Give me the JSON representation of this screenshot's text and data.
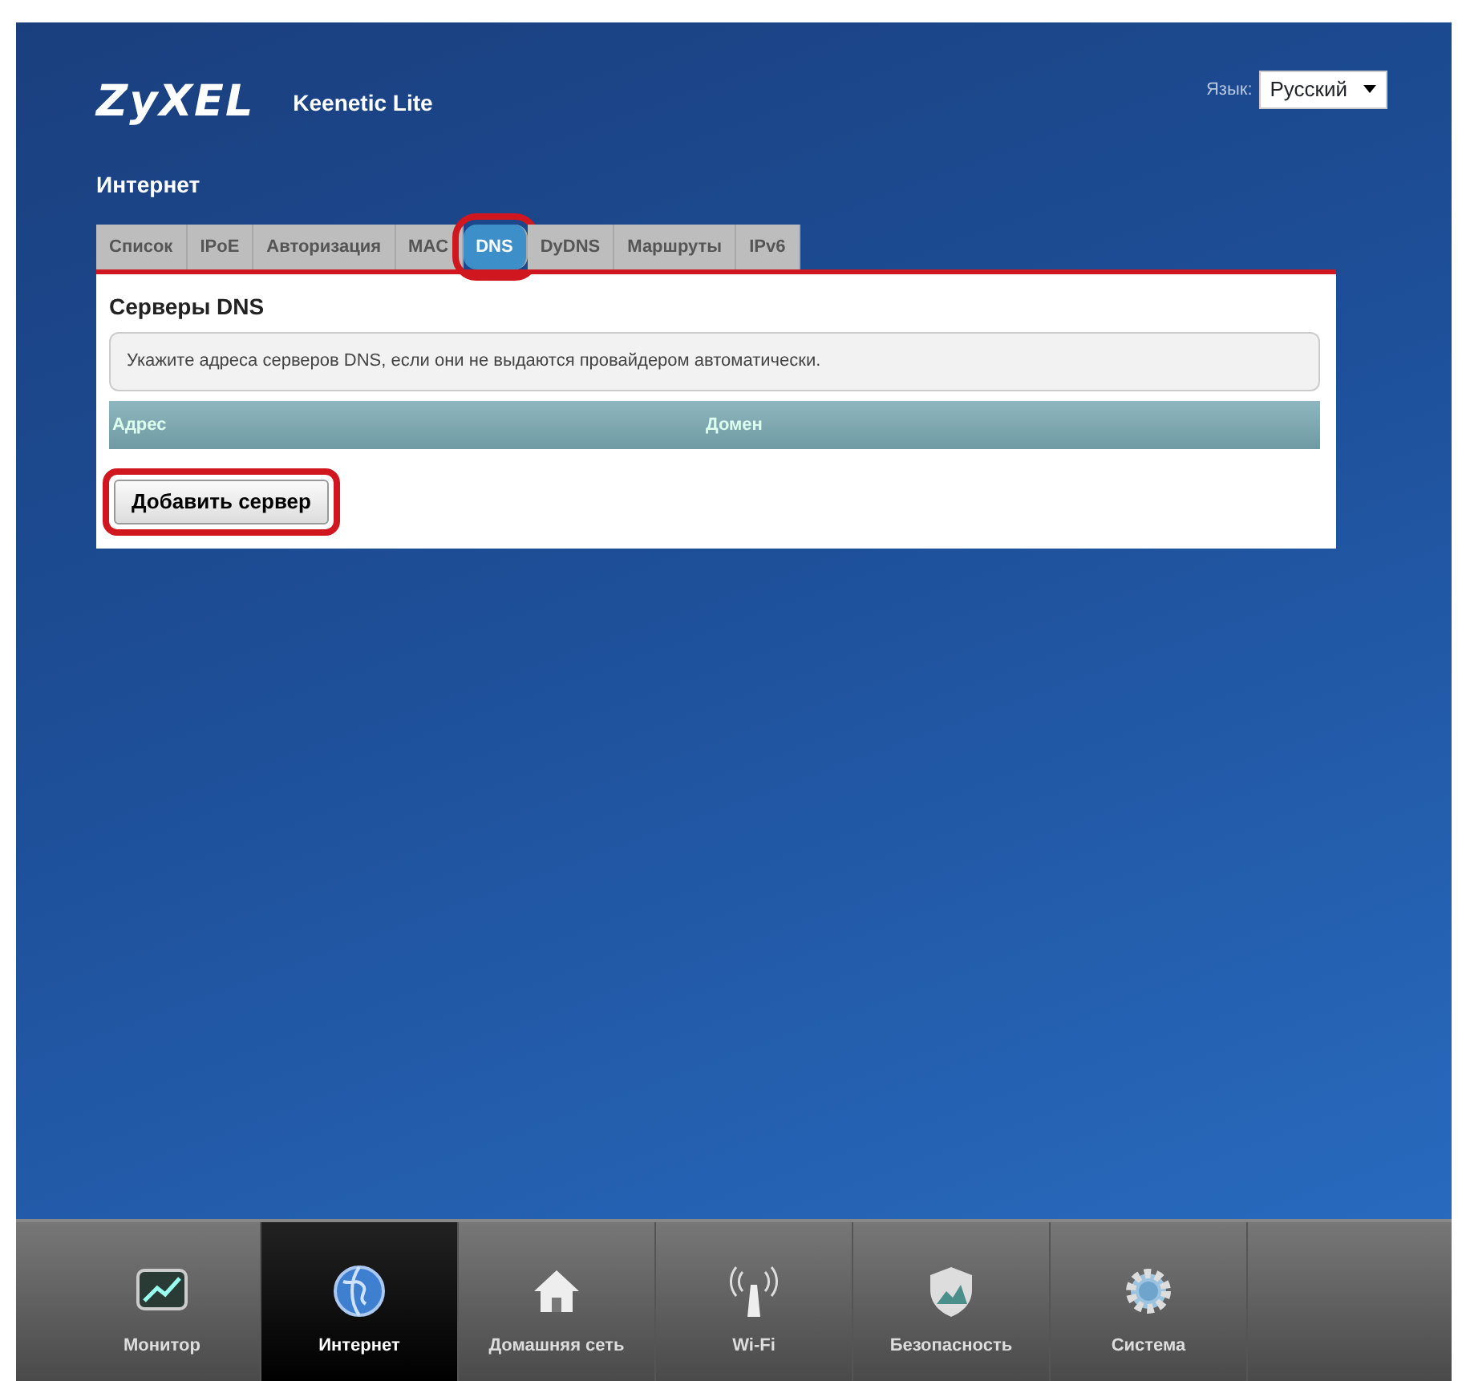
{
  "header": {
    "logo": "ZyXEL",
    "model": "Keenetic Lite",
    "language_label": "Язык:",
    "language_value": "Русский"
  },
  "page_title": "Интернет",
  "tabs": [
    {
      "label": "Список",
      "selected": false,
      "highlighted": false
    },
    {
      "label": "IPoE",
      "selected": false,
      "highlighted": false
    },
    {
      "label": "Авторизация",
      "selected": false,
      "highlighted": false
    },
    {
      "label": "MAC",
      "selected": false,
      "highlighted": false
    },
    {
      "label": "DNS",
      "selected": true,
      "highlighted": true
    },
    {
      "label": "DyDNS",
      "selected": false,
      "highlighted": false
    },
    {
      "label": "Маршруты",
      "selected": false,
      "highlighted": false
    },
    {
      "label": "IPv6",
      "selected": false,
      "highlighted": false
    }
  ],
  "panel": {
    "title": "Серверы DNS",
    "hint": "Укажите адреса серверов DNS, если они не выдаются провайдером автоматически.",
    "table": {
      "columns": [
        "Адрес",
        "Домен"
      ]
    },
    "button": {
      "label": "Добавить сервер",
      "highlighted": true
    }
  },
  "bottom_nav": [
    {
      "label": "Монитор",
      "kind": "monitor",
      "selected": false
    },
    {
      "label": "Интернет",
      "kind": "globe",
      "selected": true
    },
    {
      "label": "Домашняя сеть",
      "kind": "home",
      "selected": false
    },
    {
      "label": "Wi-Fi",
      "kind": "wifi",
      "selected": false
    },
    {
      "label": "Безопасность",
      "kind": "shield",
      "selected": false
    },
    {
      "label": "Система",
      "kind": "gear",
      "selected": false
    }
  ]
}
